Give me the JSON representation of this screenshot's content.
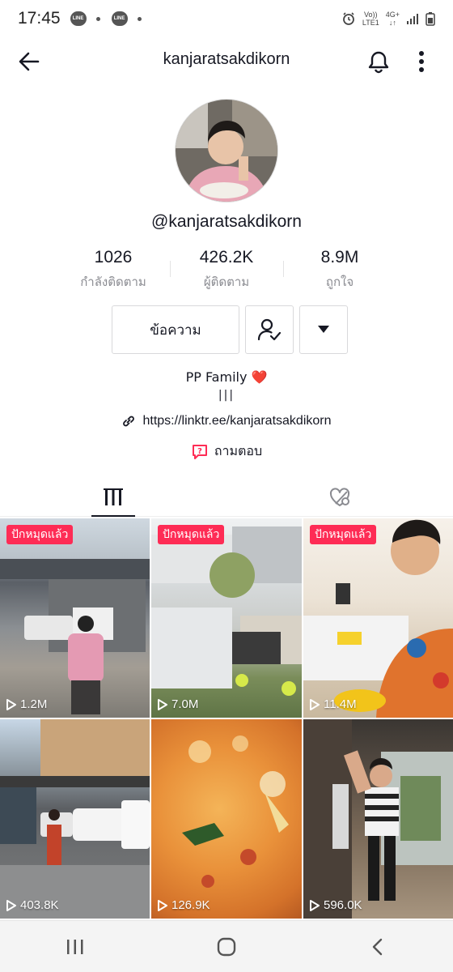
{
  "status_bar": {
    "time": "17:45",
    "app_badges": [
      "LINE",
      "LINE"
    ],
    "network": {
      "volte": "Vo))",
      "lte": "LTE1",
      "gen": "4G+"
    }
  },
  "header": {
    "title": "kanjaratsakdikorn",
    "icons": [
      "back-arrow-icon",
      "bell-icon",
      "more-vertical-icon"
    ]
  },
  "profile": {
    "handle": "@kanjaratsakdikorn",
    "stats": [
      {
        "value": "1026",
        "label": "กำลังติดตาม"
      },
      {
        "value": "426.2K",
        "label": "ผู้ติดตาม"
      },
      {
        "value": "8.9M",
        "label": "ถูกใจ"
      }
    ],
    "message_button": "ข้อความ",
    "bio_line1": "PP Family ❤️",
    "bio_line2": "|||",
    "link": "https://linktr.ee/kanjaratsakdikorn",
    "qa_label": "ถามตอบ"
  },
  "tabs": [
    {
      "icon": "grid-icon",
      "active": true
    },
    {
      "icon": "liked-heart-icon",
      "active": false
    }
  ],
  "videos": [
    {
      "tag": "ปักหมุดแล้ว",
      "views": "1.2M"
    },
    {
      "tag": "ปักหมุดแล้ว",
      "views": "7.0M"
    },
    {
      "tag": "ปักหมุดแล้ว",
      "views": "11.4M"
    },
    {
      "tag": "",
      "views": "403.8K"
    },
    {
      "tag": "",
      "views": "126.9K"
    },
    {
      "tag": "",
      "views": "596.0K"
    }
  ],
  "colors": {
    "accent": "#fe2c55",
    "text": "#161823",
    "muted": "#8a8b91"
  },
  "system_nav": [
    "recent-apps-icon",
    "home-icon",
    "back-icon"
  ]
}
